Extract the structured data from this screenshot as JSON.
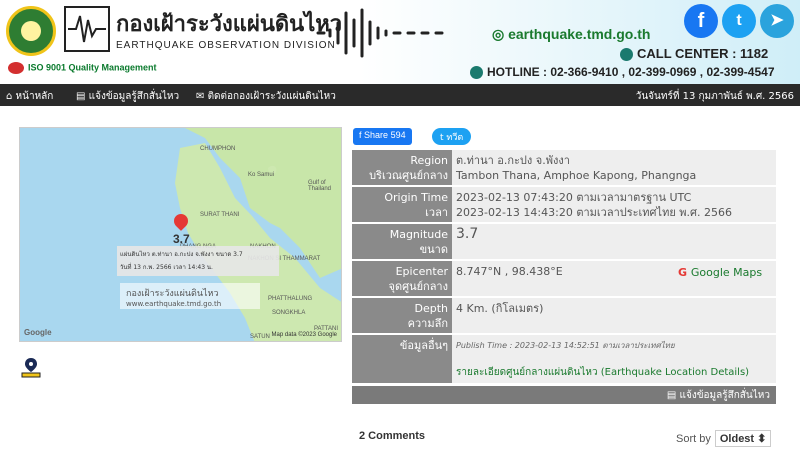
{
  "header": {
    "thai_title": "กองเฝ้าระวังแผ่นดินไหว",
    "en_title": "EARTHQUAKE OBSERVATION DIVISION",
    "iso": "ISO 9001 Quality Management",
    "site": "earthquake.tmd.go.th",
    "call_center": "CALL CENTER : 1182",
    "hotline": "HOTLINE : 02-366-9410 , 02-399-0969 , 02-399-4547",
    "facebook_icon": "facebook-icon",
    "twitter_icon": "twitter-icon",
    "telegram_icon": "telegram-icon"
  },
  "nav": {
    "home": "หน้าหลัก",
    "report": "แจ้งข้อมูลรู้สึกสั่นไหว",
    "contact": "ติดต่อกองเฝ้าระวังแผ่นดินไหว",
    "date": "วันจันทร์ที่ 13 กุมภาพันธ์ พ.ศ. 2566"
  },
  "map": {
    "labels": [
      "CHUMPHON",
      "Ko Samui",
      "SURAT THANI",
      "Gulf of Thailand",
      "PHANG NGA",
      "NAKHON",
      "NAKHON SI THAMMARAT",
      "PHATTHALUNG",
      "SONGKHLA",
      "PATTANI",
      "SATUN"
    ],
    "popup_line1": "แผ่นดินไหว ต.ท่านา อ.กะปง จ.พังงา ขนาด 3.7",
    "popup_line2": "วันที่ 13 ก.พ. 2566 เวลา 14:43 น.",
    "magnitude_marker": "3.7",
    "watermark": "กองเฝ้าระวังแผ่นดินไหว",
    "watermark_url": "www.earthquake.tmd.go.th",
    "google": "Google",
    "mapdata": "Map data ©2023 Google"
  },
  "social": {
    "share_label": "Share",
    "share_count": "594",
    "tweet_label": "ทวีต"
  },
  "details": {
    "region_label": "Region\nบริเวณศูนย์กลาง",
    "region_th": "ต.ท่านา อ.กะปง จ.พังงา",
    "region_en": "Tambon Thana, Amphoe Kapong, Phangnga",
    "origin_label": "Origin Time\nเวลา",
    "origin_utc": "2023-02-13 07:43:20 ตามเวลามาตรฐาน UTC",
    "origin_local": "2023-02-13 14:43:20 ตามเวลาประเทศไทย พ.ศ. 2566",
    "mag_label": "Magnitude\nขนาด",
    "magnitude": "3.7",
    "epi_label": "Epicenter\nจุดศูนย์กลาง",
    "epicenter": "8.747°N , 98.438°E",
    "google_maps": "Google Maps",
    "depth_label": "Depth\nความลึก",
    "depth": "4 Km. (กิโลเมตร)",
    "other_label": "ข้อมูลอื่นๆ",
    "publish": "Publish Time : 2023-02-13 14:52:51 ตามเวลาประเทศไทย",
    "location_details": "รายละเอียดศูนย์กลางแผ่นดินไหว (Earthquake Location Details)",
    "report_button": "แจ้งข้อมูลรู้สึกสั่นไหว"
  },
  "comments": {
    "count": "2 Comments",
    "sort_label": "Sort by",
    "sort_value": "Oldest"
  }
}
